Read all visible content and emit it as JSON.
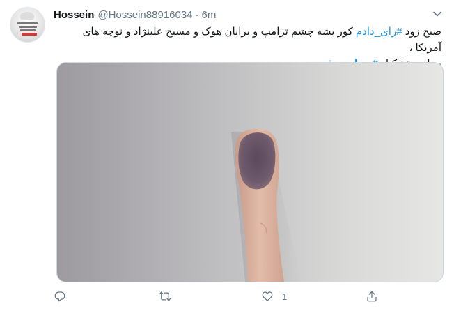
{
  "tweet": {
    "author_name": "Hossein",
    "author_handle": "@Hossein88916034",
    "separator": "·",
    "time": "6m",
    "text_line1_pre": "صبح زود ",
    "text_hashtag1": "#رای_دادم",
    "text_line1_post": " کور بشه چشم ترامپ و برایان هوک و مسیح علینژاد و نوچه های آمریکا ،",
    "text_line2_pre": " به امید تشکیل ",
    "text_hashtag2": "#مجلس_قوی"
  },
  "actions": {
    "reply_count": "",
    "retweet_count": "",
    "like_count": "1",
    "share_count": ""
  },
  "icons": {
    "avatar": "avatar",
    "caret": "chevron-down-icon",
    "reply": "reply-icon",
    "retweet": "retweet-icon",
    "like": "heart-icon",
    "share": "share-icon"
  },
  "colors": {
    "link": "#1b95e0",
    "muted": "#657786",
    "text": "#14171a"
  }
}
